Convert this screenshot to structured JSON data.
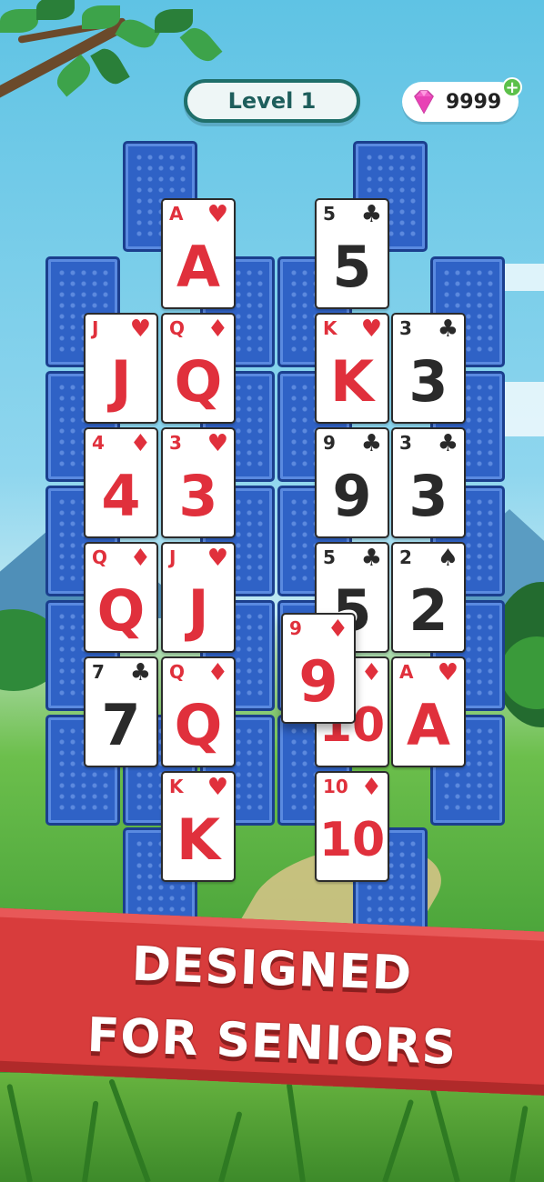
{
  "header": {
    "level_label": "Level 1",
    "gem_count": "9999",
    "gem_plus": "+"
  },
  "colors": {
    "red_suit": "#e0303c",
    "black_suit": "#2a2a2a",
    "card_back": "#2f62c6",
    "banner": "#d83c3c",
    "level_border": "#1f6f6a"
  },
  "icons": {
    "gem": "pink-diamond-icon",
    "plus": "plus-icon"
  },
  "cards": [
    {
      "rank": "A",
      "suit": "♥",
      "color": "red"
    },
    {
      "rank": "5",
      "suit": "♣",
      "color": "black"
    },
    {
      "rank": "J",
      "suit": "♥",
      "color": "red"
    },
    {
      "rank": "Q",
      "suit": "♦",
      "color": "red"
    },
    {
      "rank": "K",
      "suit": "♥",
      "color": "red"
    },
    {
      "rank": "3",
      "suit": "♣",
      "color": "black"
    },
    {
      "rank": "4",
      "suit": "♦",
      "color": "red"
    },
    {
      "rank": "3",
      "suit": "♥",
      "color": "red"
    },
    {
      "rank": "9",
      "suit": "♣",
      "color": "black"
    },
    {
      "rank": "3",
      "suit": "♣",
      "color": "black"
    },
    {
      "rank": "Q",
      "suit": "♦",
      "color": "red"
    },
    {
      "rank": "J",
      "suit": "♥",
      "color": "red"
    },
    {
      "rank": "5",
      "suit": "♣",
      "color": "black"
    },
    {
      "rank": "2",
      "suit": "♠",
      "color": "black"
    },
    {
      "rank": "7",
      "suit": "♣",
      "color": "black"
    },
    {
      "rank": "Q",
      "suit": "♦",
      "color": "red"
    },
    {
      "rank": "10",
      "suit": "♦",
      "color": "red"
    },
    {
      "rank": "A",
      "suit": "♥",
      "color": "red"
    },
    {
      "rank": "K",
      "suit": "♥",
      "color": "red"
    },
    {
      "rank": "10",
      "suit": "♦",
      "color": "red"
    },
    {
      "rank": "9",
      "suit": "♦",
      "color": "red"
    }
  ],
  "banner": {
    "line1": "DESIGNED",
    "line2": "FOR SENIORS"
  }
}
